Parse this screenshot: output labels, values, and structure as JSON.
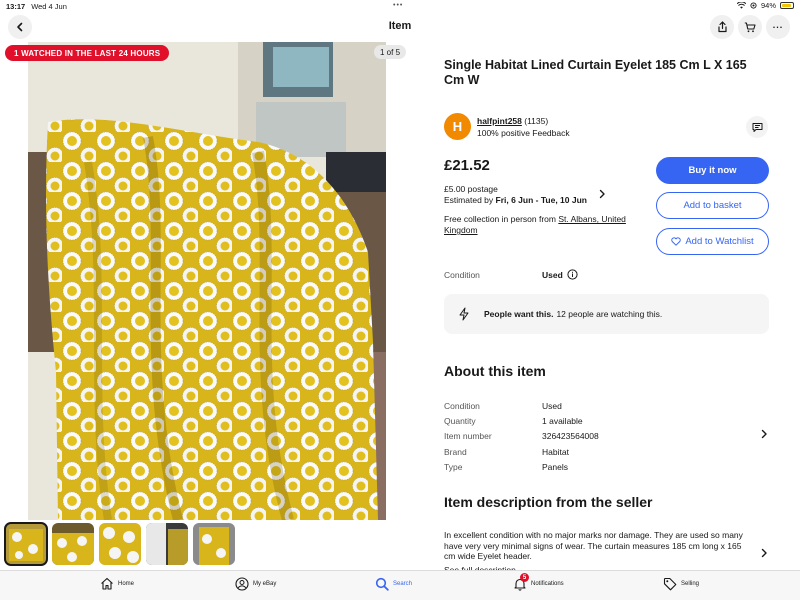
{
  "status_bar": {
    "time": "13:17",
    "date": "Wed 4 Jun",
    "battery": "94%",
    "battery_level": 0.94
  },
  "nav": {
    "title": "Item"
  },
  "gallery": {
    "watched_badge": "1 WATCHED IN THE LAST 24 HOURS",
    "counter": "1 of 5",
    "thumbnail_count": 5
  },
  "item": {
    "title": "Single Habitat Lined Curtain Eyelet 185 Cm L X 165 Cm W",
    "price": "£21.52"
  },
  "seller": {
    "initial": "H",
    "name": "halfpint258",
    "feedback_count": "(1135)",
    "feedback_text": "100% positive Feedback"
  },
  "shipping": {
    "postage": "£5.00 postage",
    "estimated_prefix": "Estimated by ",
    "estimated_dates": "Fri, 6 Jun - Tue, 10 Jun",
    "collection_prefix": "Free collection in person from ",
    "collection_location": "St. Albans, United Kingdom"
  },
  "actions": {
    "buy_now": "Buy it now",
    "add_to_basket": "Add to basket",
    "add_to_watchlist": "Add to Watchlist"
  },
  "condition": {
    "label": "Condition",
    "value": "Used"
  },
  "demand": {
    "bold": "People want this.",
    "text": "12 people are watching this."
  },
  "about": {
    "heading": "About this item",
    "rows": [
      {
        "label": "Condition",
        "value": "Used"
      },
      {
        "label": "Quantity",
        "value": "1 available"
      },
      {
        "label": "Item number",
        "value": "326423564008"
      },
      {
        "label": "Brand",
        "value": "Habitat"
      },
      {
        "label": "Type",
        "value": "Panels"
      }
    ]
  },
  "description": {
    "heading": "Item description from the seller",
    "text": "In excellent condition with no major marks nor damage. They are used so many have very very minimal signs of wear. The curtain measures 185 cm long x 165 cm wide Eyelet header.",
    "see_full": "See full description"
  },
  "tabbar": {
    "home": "Home",
    "my_ebay": "My eBay",
    "search": "Search",
    "notifications": "Notifications",
    "notifications_badge": "5",
    "selling": "Selling"
  },
  "colors": {
    "accent": "#3665f3",
    "badge_red": "#e0102b",
    "avatar": "#f18a00",
    "fabric": "#d9b81c"
  }
}
